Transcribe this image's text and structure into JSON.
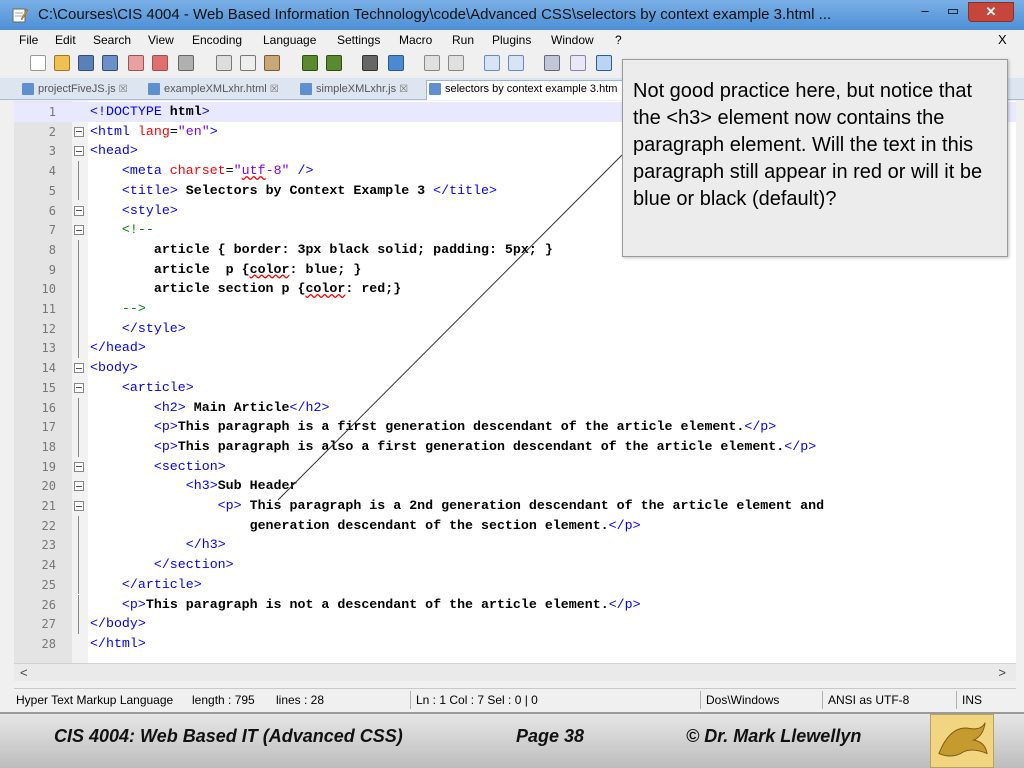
{
  "window": {
    "title": "C:\\Courses\\CIS 4004 - Web Based Information Technology\\code\\Advanced CSS\\selectors by context example 3.html ...",
    "minimize": "–",
    "maximize": "▭",
    "close": "✕"
  },
  "menu": {
    "items": [
      "File",
      "Edit",
      "Search",
      "View",
      "Encoding",
      "Language",
      "Settings",
      "Macro",
      "Run",
      "Plugins",
      "Window",
      "?"
    ],
    "close": "X"
  },
  "tabs": [
    {
      "label": "projectFiveJS.js",
      "close": "☒"
    },
    {
      "label": "exampleXMLxhr.html",
      "close": "☒"
    },
    {
      "label": "simpleXMLxhr.js",
      "close": "☒"
    },
    {
      "label": "selectors by context example 3.htm"
    }
  ],
  "code_lines": [
    "<!DOCTYPE html>",
    "<html lang=\"en\">",
    "<head>",
    "    <meta charset=\"utf-8\" />",
    "    <title> Selectors by Context Example 3 </title>",
    "    <style>",
    "    <!--",
    "        article { border: 3px black solid; padding: 5px; }",
    "        article  p {color: blue; }",
    "        article section p {color: red;}",
    "    -->",
    "    </style>",
    "</head>",
    "<body>",
    "    <article>",
    "        <h2> Main Article</h2>",
    "        <p>This paragraph is a first generation descendant of the article element.</p>",
    "        <p>This paragraph is also a first generation descendant of the article element.</p>",
    "        <section>",
    "            <h3>Sub Header",
    "                <p> This paragraph is a 2nd generation descendant of the article element and",
    "                    generation descendant of the section element.</p>",
    "            </h3>",
    "        </section>",
    "    </article>",
    "    <p>This paragraph is not a descendant of the article element.</p>",
    "</body>",
    "</html>"
  ],
  "scroll": {
    "left": "<",
    "right": ">"
  },
  "status": {
    "language": "Hyper Text Markup Language",
    "length": "length : 795",
    "lines": "lines : 28",
    "position": "Ln : 1    Col : 7    Sel : 0 | 0",
    "eol": "Dos\\Windows",
    "encoding": "ANSI as UTF-8",
    "mode": "INS"
  },
  "callout": {
    "text": "Not good practice here, but notice that the <h3> element now contains the paragraph element.  Will the text in this paragraph still appear in red or will it be blue or black (default)?"
  },
  "footer": {
    "course": "CIS 4004: Web Based IT (Advanced CSS)",
    "page": "Page 38",
    "author": "© Dr. Mark Llewellyn"
  },
  "colors": {
    "tag": "#0000ff",
    "attr": "#ff0000",
    "value": "#8000ff",
    "comment": "#008000"
  }
}
